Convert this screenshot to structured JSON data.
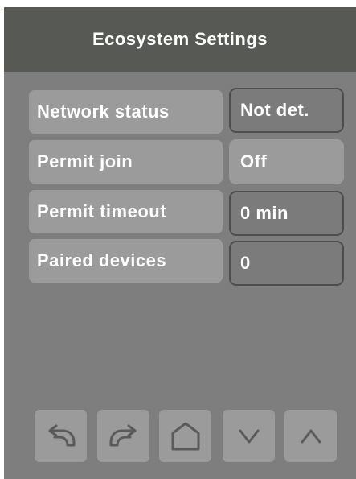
{
  "header": {
    "title": "Ecosystem Settings"
  },
  "settings": [
    {
      "label": "Network status",
      "value": "Not det."
    },
    {
      "label": "Permit join",
      "value": "Off"
    },
    {
      "label": "Permit timeout",
      "value": "0 min"
    },
    {
      "label": "Paired devices",
      "value": "0"
    }
  ],
  "nav": {
    "buttons": [
      {
        "icon": "undo-icon"
      },
      {
        "icon": "redo-icon"
      },
      {
        "icon": "home-icon"
      },
      {
        "icon": "chevron-down-icon"
      },
      {
        "icon": "chevron-up-icon"
      }
    ]
  },
  "colors": {
    "panel_bg": "#7e7e7e",
    "header_bg": "#575955",
    "button_bg": "#9b9b9b",
    "outline": "#4e4e4e",
    "text": "#ffffff",
    "icon_stroke": "#5a5a5a"
  }
}
